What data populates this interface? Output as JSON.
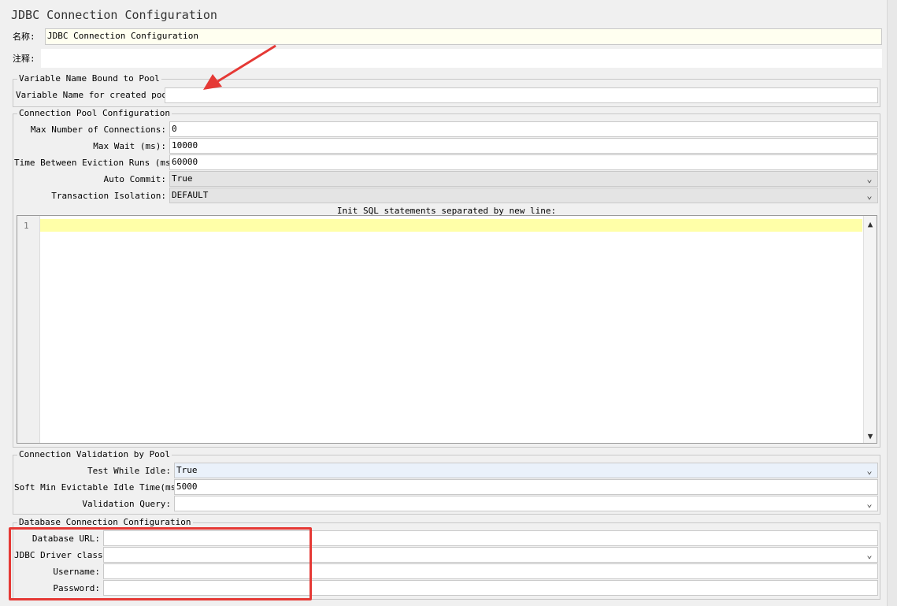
{
  "window_title": "JDBC Connection Configuration",
  "name_label": "名称:",
  "name_value": "JDBC Connection Configuration",
  "comment_label": "注释:",
  "comment_value": "",
  "var_section": {
    "legend": "Variable Name Bound to Pool",
    "var_label": "Variable Name for created pool:",
    "var_value": ""
  },
  "pool_section": {
    "legend": "Connection Pool Configuration",
    "max_conn_label": "Max Number of Connections:",
    "max_conn_value": "0",
    "max_wait_label": "Max Wait (ms):",
    "max_wait_value": "10000",
    "eviction_label": "Time Between Eviction Runs (ms):",
    "eviction_value": "60000",
    "auto_commit_label": "Auto Commit:",
    "auto_commit_value": "True",
    "isolation_label": "Transaction Isolation:",
    "isolation_value": "DEFAULT",
    "init_sql_label": "Init SQL statements separated by new line:",
    "line_number": "1"
  },
  "validation_section": {
    "legend": "Connection Validation by Pool",
    "test_idle_label": "Test While Idle:",
    "test_idle_value": "True",
    "soft_min_label": "Soft Min Evictable Idle Time(ms):",
    "soft_min_value": "5000",
    "query_label": "Validation Query:",
    "query_value": ""
  },
  "db_section": {
    "legend": "Database Connection Configuration",
    "url_label": "Database URL:",
    "url_value": "",
    "driver_label": "JDBC Driver class:",
    "driver_value": "",
    "username_label": "Username:",
    "username_value": "",
    "password_label": "Password:",
    "password_value": ""
  },
  "icons": {
    "dropdown": "chevron-down-icon",
    "scroll_up": "scroll-up-icon",
    "scroll_down": "scroll-down-icon",
    "annotation_arrow": "arrow-annotation-icon"
  },
  "colors": {
    "annotation_red": "#e53935",
    "editor_highlight": "#ffffa8",
    "name_field_bg": "#fffff0"
  }
}
